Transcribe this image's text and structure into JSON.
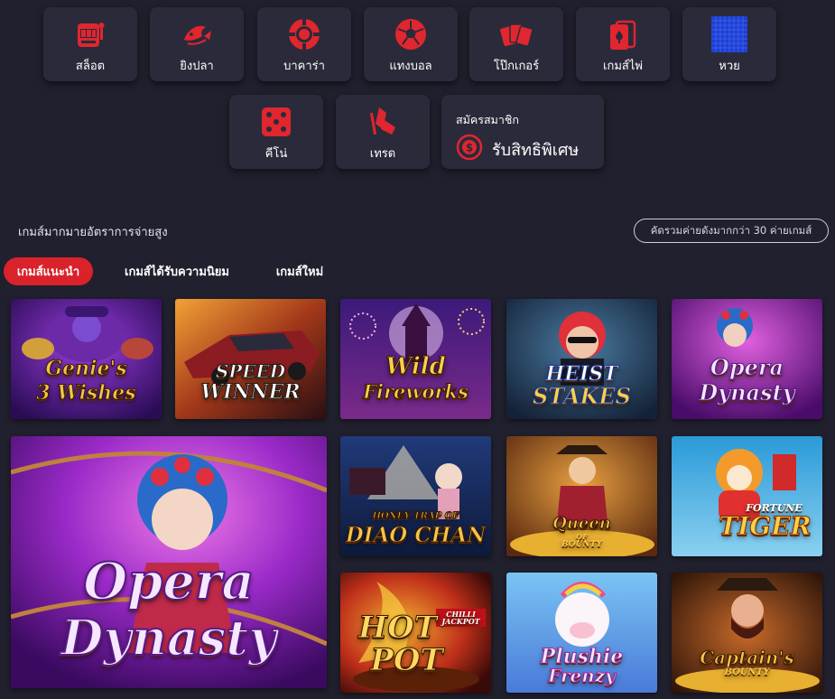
{
  "categories": [
    {
      "label": "สล็อต",
      "icon": "slot-machine-icon"
    },
    {
      "label": "ยิงปลา",
      "icon": "fish-icon"
    },
    {
      "label": "บาคาร่า",
      "icon": "poker-chip-icon"
    },
    {
      "label": "แทงบอล",
      "icon": "soccer-ball-icon"
    },
    {
      "label": "โป๊กเกอร์",
      "icon": "cards-icon"
    },
    {
      "label": "เกมส์ไพ่",
      "icon": "playing-card-icon"
    },
    {
      "label": "หวย",
      "icon": "lottery-grid-icon"
    },
    {
      "label": "คีโน่",
      "icon": "dice-icon"
    },
    {
      "label": "เทรด",
      "icon": "trade-flag-icon"
    }
  ],
  "promo": {
    "small": "สมัครสมาชิก",
    "big": "รับสิทธิพิเศษ",
    "icon": "dollar-coin-icon"
  },
  "headline": "เกมส์มากมายอัตราการจ่ายสูง",
  "providers_pill": "คัดรวมค่ายดังมากกว่า 30 ค่ายเกมส์",
  "tabs": [
    "เกมส์แนะนำ",
    "เกมส์ได้รับความนิยม",
    "เกมส์ใหม่"
  ],
  "games": [
    {
      "line1": "Genie's",
      "line2": "3 Wishes",
      "small": ""
    },
    {
      "line1": "SPEED",
      "line2": "WINNER",
      "small": ""
    },
    {
      "line1": "Wild",
      "line2": "Fireworks",
      "small": ""
    },
    {
      "line1": "HEIST",
      "line2": "STAKES",
      "small": ""
    },
    {
      "line1": "Opera",
      "line2": "Dynasty",
      "small": ""
    },
    {
      "line1": "Opera",
      "line2": "Dynasty",
      "small": ""
    },
    {
      "line1": "HONEY TRAP OF",
      "line2": "DIAO CHAN",
      "small": ""
    },
    {
      "line1": "Queen",
      "line2": "BOUNTY",
      "small": "OF"
    },
    {
      "line1": "FORTUNE",
      "line2": "TIGER",
      "small": ""
    },
    {
      "line1": "HOT",
      "line2": "POT",
      "small": "CHILLI JACKPOT"
    },
    {
      "line1": "Plushie",
      "line2": "Frenzy",
      "small": ""
    },
    {
      "line1": "Captain's",
      "line2": "BOUNTY",
      "small": ""
    }
  ],
  "colors": {
    "background": "#21202e",
    "card": "#2b2a3b",
    "accent": "#d9222a",
    "icon": "#e0262e"
  }
}
